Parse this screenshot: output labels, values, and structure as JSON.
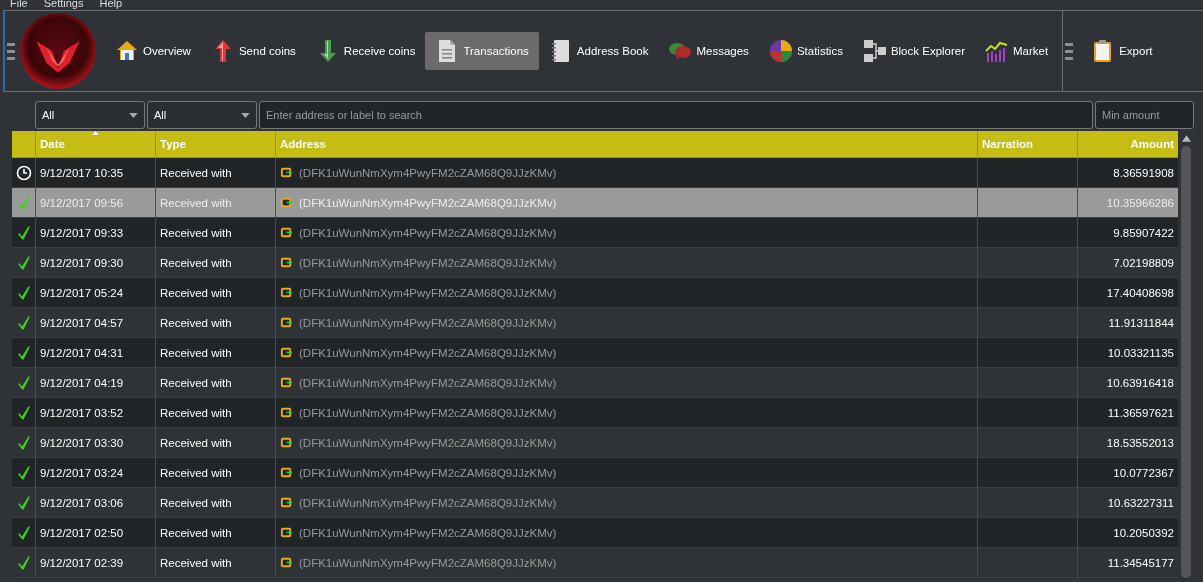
{
  "menu": [
    "File",
    "Settings",
    "Help"
  ],
  "toolbar": [
    {
      "kind": "overview",
      "label": "Overview",
      "selected": false
    },
    {
      "kind": "send",
      "label": "Send coins",
      "selected": false
    },
    {
      "kind": "receive",
      "label": "Receive coins",
      "selected": false
    },
    {
      "kind": "transactions",
      "label": "Transactions",
      "selected": true
    },
    {
      "kind": "addressbook",
      "label": "Address Book",
      "selected": false
    },
    {
      "kind": "messages",
      "label": "Messages",
      "selected": false
    },
    {
      "kind": "statistics",
      "label": "Statistics",
      "selected": false
    },
    {
      "kind": "explorer",
      "label": "Block Explorer",
      "selected": false
    },
    {
      "kind": "market",
      "label": "Market",
      "selected": false
    }
  ],
  "toolbar_extra": [
    {
      "kind": "export",
      "label": "Export",
      "selected": false
    }
  ],
  "filters": {
    "date": "All",
    "type": "All",
    "search": {
      "placeholder": "Enter address or label to search"
    },
    "min_amount": {
      "placeholder": "Min amount"
    }
  },
  "table": {
    "columns": [
      "Date",
      "Type",
      "Address",
      "Narration",
      "Amount"
    ],
    "rows": [
      {
        "confirmed": false,
        "date": "9/12/2017 10:35",
        "type": "Received with",
        "address": "(DFK1uWunNmXym4PwyFM2cZAM68Q9JJzKMv)",
        "amount": "8.36591908",
        "selected": false
      },
      {
        "confirmed": true,
        "date": "9/12/2017 09:56",
        "type": "Received with",
        "address": "(DFK1uWunNmXym4PwyFM2cZAM68Q9JJzKMv)",
        "amount": "10.35966286",
        "selected": true
      },
      {
        "confirmed": true,
        "date": "9/12/2017 09:33",
        "type": "Received with",
        "address": "(DFK1uWunNmXym4PwyFM2cZAM68Q9JJzKMv)",
        "amount": "9.85907422",
        "selected": false
      },
      {
        "confirmed": true,
        "date": "9/12/2017 09:30",
        "type": "Received with",
        "address": "(DFK1uWunNmXym4PwyFM2cZAM68Q9JJzKMv)",
        "amount": "7.02198809",
        "selected": false
      },
      {
        "confirmed": true,
        "date": "9/12/2017 05:24",
        "type": "Received with",
        "address": "(DFK1uWunNmXym4PwyFM2cZAM68Q9JJzKMv)",
        "amount": "17.40408698",
        "selected": false
      },
      {
        "confirmed": true,
        "date": "9/12/2017 04:57",
        "type": "Received with",
        "address": "(DFK1uWunNmXym4PwyFM2cZAM68Q9JJzKMv)",
        "amount": "11.91311844",
        "selected": false
      },
      {
        "confirmed": true,
        "date": "9/12/2017 04:31",
        "type": "Received with",
        "address": "(DFK1uWunNmXym4PwyFM2cZAM68Q9JJzKMv)",
        "amount": "10.03321135",
        "selected": false
      },
      {
        "confirmed": true,
        "date": "9/12/2017 04:19",
        "type": "Received with",
        "address": "(DFK1uWunNmXym4PwyFM2cZAM68Q9JJzKMv)",
        "amount": "10.63916418",
        "selected": false
      },
      {
        "confirmed": true,
        "date": "9/12/2017 03:52",
        "type": "Received with",
        "address": "(DFK1uWunNmXym4PwyFM2cZAM68Q9JJzKMv)",
        "amount": "11.36597621",
        "selected": false
      },
      {
        "confirmed": true,
        "date": "9/12/2017 03:30",
        "type": "Received with",
        "address": "(DFK1uWunNmXym4PwyFM2cZAM68Q9JJzKMv)",
        "amount": "18.53552013",
        "selected": false
      },
      {
        "confirmed": true,
        "date": "9/12/2017 03:24",
        "type": "Received with",
        "address": "(DFK1uWunNmXym4PwyFM2cZAM68Q9JJzKMv)",
        "amount": "10.0772367",
        "selected": false
      },
      {
        "confirmed": true,
        "date": "9/12/2017 03:06",
        "type": "Received with",
        "address": "(DFK1uWunNmXym4PwyFM2cZAM68Q9JJzKMv)",
        "amount": "10.63227311",
        "selected": false
      },
      {
        "confirmed": true,
        "date": "9/12/2017 02:50",
        "type": "Received with",
        "address": "(DFK1uWunNmXym4PwyFM2cZAM68Q9JJzKMv)",
        "amount": "10.2050392",
        "selected": false
      },
      {
        "confirmed": true,
        "date": "9/12/2017 02:39",
        "type": "Received with",
        "address": "(DFK1uWunNmXym4PwyFM2cZAM68Q9JJzKMv)",
        "amount": "11.34545177",
        "selected": false
      }
    ]
  }
}
